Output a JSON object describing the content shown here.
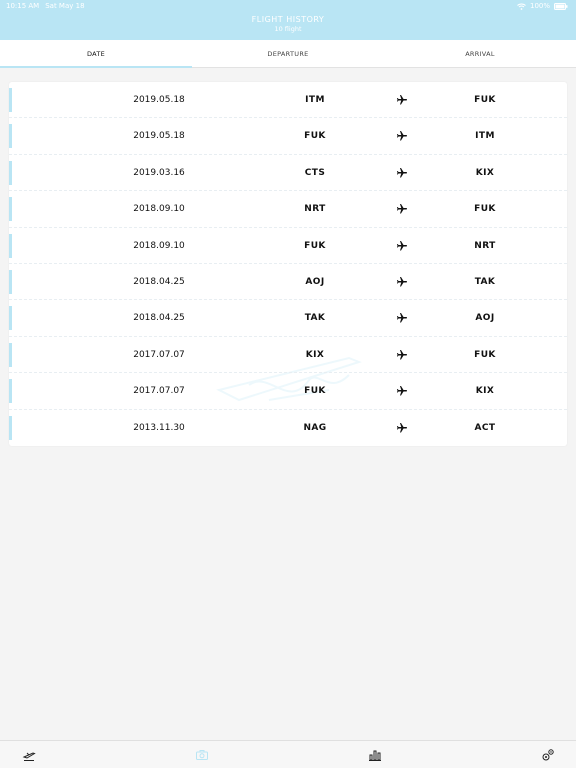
{
  "status_bar": {
    "time": "10:15 AM",
    "date": "Sat May 18",
    "battery": "100%"
  },
  "header": {
    "title": "FLIGHT HISTORY",
    "subtitle": "10 flight"
  },
  "tabs": [
    {
      "label": "DATE",
      "active": true
    },
    {
      "label": "DEPARTURE",
      "active": false
    },
    {
      "label": "ARRIVAL",
      "active": false
    }
  ],
  "flights": [
    {
      "date": "2019.05.18",
      "departure": "ITM",
      "arrival": "FUK"
    },
    {
      "date": "2019.05.18",
      "departure": "FUK",
      "arrival": "ITM"
    },
    {
      "date": "2019.03.16",
      "departure": "CTS",
      "arrival": "KIX"
    },
    {
      "date": "2018.09.10",
      "departure": "NRT",
      "arrival": "FUK"
    },
    {
      "date": "2018.09.10",
      "departure": "FUK",
      "arrival": "NRT"
    },
    {
      "date": "2018.04.25",
      "departure": "AOJ",
      "arrival": "TAK"
    },
    {
      "date": "2018.04.25",
      "departure": "TAK",
      "arrival": "AOJ"
    },
    {
      "date": "2017.07.07",
      "departure": "KIX",
      "arrival": "FUK"
    },
    {
      "date": "2017.07.07",
      "departure": "FUK",
      "arrival": "KIX"
    },
    {
      "date": "2013.11.30",
      "departure": "NAG",
      "arrival": "ACT"
    }
  ],
  "bottom_tabs": [
    {
      "icon": "takeoff-icon",
      "active": false
    },
    {
      "icon": "camera-icon",
      "active": true
    },
    {
      "icon": "bar-chart-icon",
      "active": false
    },
    {
      "icon": "settings-icon",
      "active": false
    }
  ],
  "colors": {
    "accent": "#b9e5f4",
    "background": "#f4f4f4",
    "text": "#111111"
  }
}
